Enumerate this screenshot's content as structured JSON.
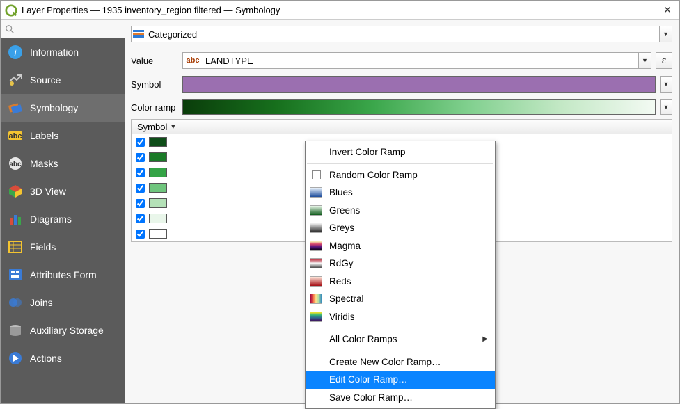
{
  "window": {
    "title": "Layer Properties — 1935 inventory_region filtered — Symbology"
  },
  "search": {
    "placeholder": ""
  },
  "sidebar": {
    "items": [
      {
        "id": "information",
        "label": "Information"
      },
      {
        "id": "source",
        "label": "Source"
      },
      {
        "id": "symbology",
        "label": "Symbology"
      },
      {
        "id": "labels",
        "label": "Labels"
      },
      {
        "id": "masks",
        "label": "Masks"
      },
      {
        "id": "3dview",
        "label": "3D View"
      },
      {
        "id": "diagrams",
        "label": "Diagrams"
      },
      {
        "id": "fields",
        "label": "Fields"
      },
      {
        "id": "attrform",
        "label": "Attributes Form"
      },
      {
        "id": "joins",
        "label": "Joins"
      },
      {
        "id": "auxstorage",
        "label": "Auxiliary Storage"
      },
      {
        "id": "actions",
        "label": "Actions"
      }
    ],
    "active": "symbology"
  },
  "symbology": {
    "renderer_type": "Categorized",
    "value_label": "Value",
    "value_field": "LANDTYPE",
    "value_field_type": "abc",
    "symbol_label": "Symbol",
    "symbol_color": "#9b6fb0",
    "colorramp_label": "Color ramp",
    "colorramp_name": "Greens",
    "table_header": {
      "symbol": "Symbol"
    },
    "categories": [
      {
        "checked": true,
        "color": "#0e4d18"
      },
      {
        "checked": true,
        "color": "#1a7a27"
      },
      {
        "checked": true,
        "color": "#34a446"
      },
      {
        "checked": true,
        "color": "#6fc57d"
      },
      {
        "checked": true,
        "color": "#b4e1b7"
      },
      {
        "checked": true,
        "color": "#e9f6ea"
      },
      {
        "checked": true,
        "color": "#ffffff"
      }
    ]
  },
  "ramp_menu": {
    "invert": "Invert Color Ramp",
    "random": "Random Color Ramp",
    "presets": [
      {
        "name": "Blues",
        "grad": "linear-gradient(#e7f1fb,#1f4e9c)"
      },
      {
        "name": "Greens",
        "grad": "linear-gradient(#e8f6e8,#0e5a1a)"
      },
      {
        "name": "Greys",
        "grad": "linear-gradient(#f4f4f4,#222)"
      },
      {
        "name": "Magma",
        "grad": "linear-gradient(0deg,#000004,#59157e 40%,#d9466b 70%,#fcfdbf)"
      },
      {
        "name": "RdGy",
        "grad": "linear-gradient(#b2182b,#f7f7f7 50%,#4d4d4d)"
      },
      {
        "name": "Reds",
        "grad": "linear-gradient(#fee5d9,#a50f15)"
      },
      {
        "name": "Spectral",
        "grad": "linear-gradient(90deg,#9e0142,#f46d43,#fee08b,#abdda4,#3288bd)"
      },
      {
        "name": "Viridis",
        "grad": "linear-gradient(0deg,#440154,#31688e 40%,#35b779 70%,#fde725)"
      }
    ],
    "all": "All Color Ramps",
    "create": "Create New Color Ramp…",
    "edit": "Edit Color Ramp…",
    "save": "Save Color Ramp…",
    "selected": "edit"
  }
}
